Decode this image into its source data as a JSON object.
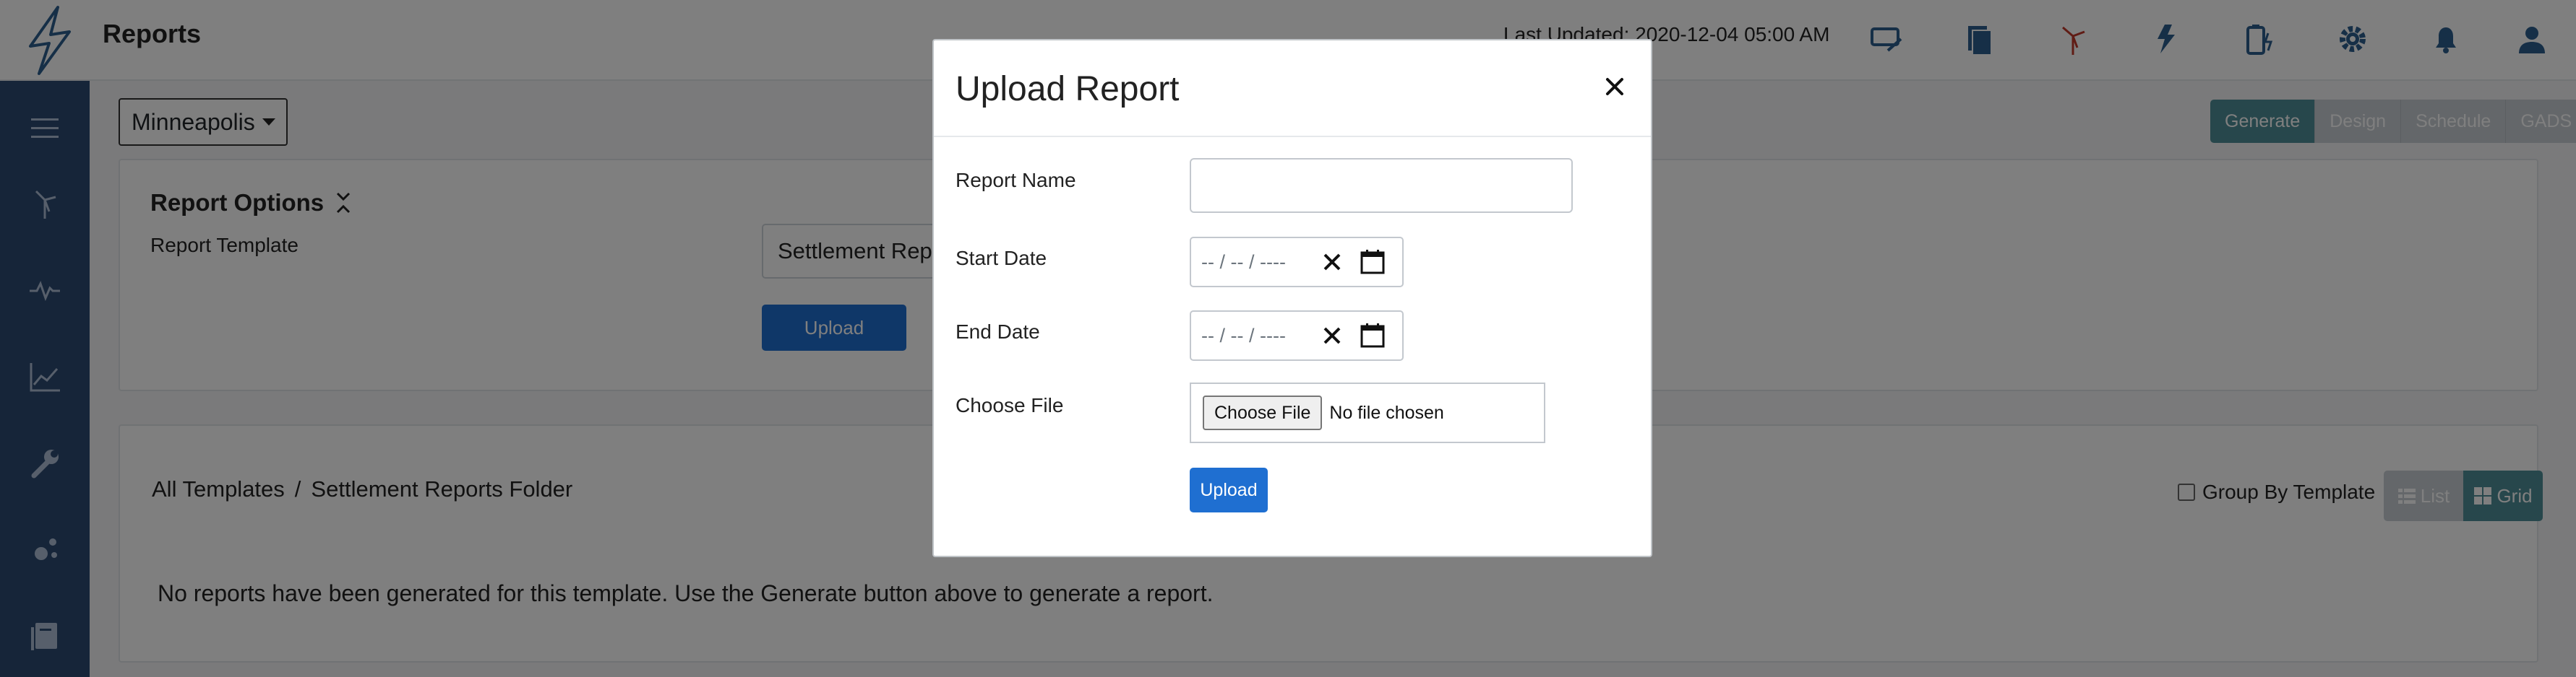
{
  "header": {
    "app_title": "Reports",
    "last_updated": "Last Updated: 2020-12-04 05:00 AM",
    "icons": [
      "monitor-arrow-icon",
      "documents-icon",
      "wind-turbine-icon",
      "lightning-grid-icon",
      "battery-icon",
      "gear-icon",
      "bell-icon",
      "user-icon"
    ],
    "accent_color": "#2c4a73"
  },
  "sidebar": {
    "icons": [
      "hamburger-menu-icon",
      "wind-turbine-icon",
      "pulse-icon",
      "line-chart-icon",
      "wrench-icon",
      "nodes-icon",
      "book-icon"
    ]
  },
  "main": {
    "city_select": "Minneapolis",
    "mode_buttons": [
      {
        "label": "Generate",
        "active": true
      },
      {
        "label": "Design",
        "active": false
      },
      {
        "label": "Schedule",
        "active": false
      },
      {
        "label": "GADS",
        "active": false
      }
    ],
    "report_options": {
      "title": "Report Options",
      "template_label": "Report Template",
      "template_value": "Settlement Repo",
      "upload_label": "Upload"
    },
    "reports": {
      "breadcrumb": [
        "All Templates",
        "/",
        "Settlement Reports Folder"
      ],
      "group_by_label": "Group By Template",
      "view_list_label": "List",
      "view_grid_label": "Grid",
      "empty_message": "No reports have been generated for this template. Use the Generate button above to generate a report."
    }
  },
  "modal": {
    "title": "Upload Report",
    "fields": {
      "report_name_label": "Report Name",
      "report_name_value": "",
      "start_date_label": "Start Date",
      "start_date_placeholder": "-- / -- / ----",
      "end_date_label": "End Date",
      "end_date_placeholder": "-- / -- / ----",
      "choose_file_label": "Choose File",
      "choose_file_button": "Choose File",
      "no_file_text": "No file chosen"
    },
    "upload_label": "Upload"
  }
}
